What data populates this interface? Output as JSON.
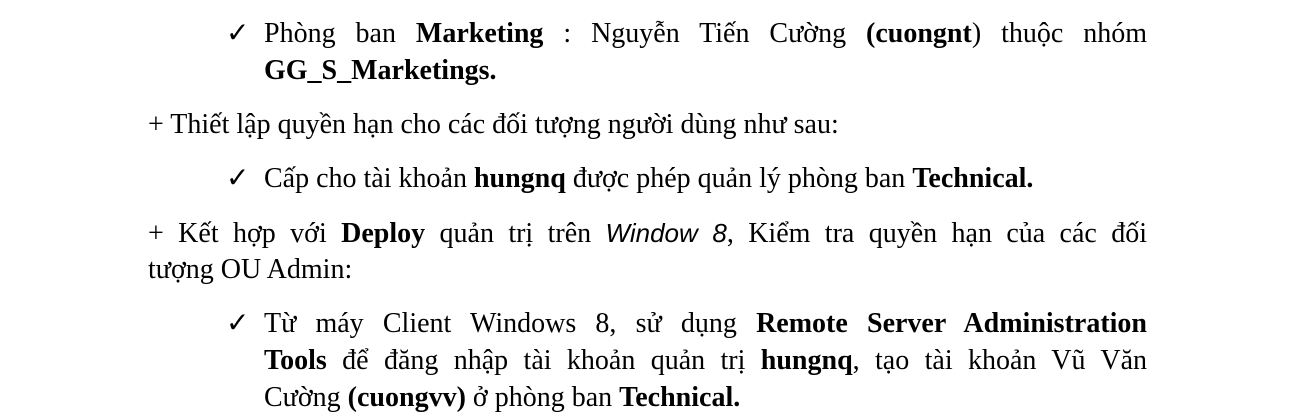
{
  "document": {
    "bullet_check": "✓",
    "b1": {
      "t1": "Phòng ban ",
      "t2": "Marketing",
      "t3": " : Nguyễn Tiến Cường ",
      "t4": "(cuongnt",
      "t5": ") thuộc nhóm",
      "t6": "GG_S_Marketings."
    },
    "p1": {
      "text": "+ Thiết lập quyền hạn cho các đối tượng người dùng như sau:"
    },
    "b2": {
      "t1": "Cấp cho tài khoản ",
      "t2": "hungnq",
      "t3": " được phép quản lý phòng ban ",
      "t4": "Technical."
    },
    "p2": {
      "t1": "+ Kết hợp với ",
      "t2": "Deploy",
      "t3": " quản trị trên ",
      "t4": "Window 8",
      "t5": ", Kiểm tra quyền hạn của các đối",
      "t6": "tượng OU Admin:"
    },
    "b3": {
      "t1": "Từ máy Client Windows 8, sử dụng ",
      "t2": "Remote Server Administration",
      "t3": "Tools",
      "t4": " để đăng nhập tài khoản quản trị ",
      "t5": "hungnq",
      "t6": ", tạo tài khoản Vũ Văn",
      "t7": "Cường ",
      "t8": "(cuongvv)",
      "t9": " ở phòng ban ",
      "t10": "Technical."
    }
  }
}
